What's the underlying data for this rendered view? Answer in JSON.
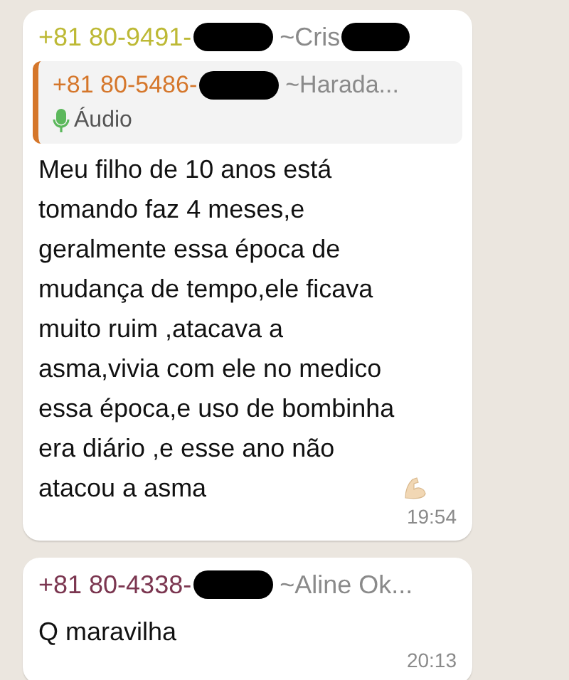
{
  "messages": [
    {
      "sender": {
        "number": "+81 80-9491-",
        "name": "~Cris",
        "color": "#bdb935",
        "name_redacted": true
      },
      "quote": {
        "sender": {
          "number": "+81 80-5486-",
          "name": "~Harada...",
          "color": "#d5762a"
        },
        "text": "Áudio"
      },
      "text_lines": [
        "Meu filho de 10 anos está",
        "tomando faz 4 meses,e",
        "geralmente essa época de",
        "mudança de tempo,ele ficava",
        "muito ruim ,atacava a",
        "asma,vivia com ele no medico",
        "essa época,e uso de bombinha",
        "era diário ,e esse ano não",
        "atacou a asma"
      ],
      "time": "19:54"
    },
    {
      "sender": {
        "number": "+81 80-4338-",
        "name": "~Aline Ok...",
        "color": "#7b3650"
      },
      "text_lines": [
        "Q maravilha"
      ],
      "time": "20:13"
    }
  ]
}
